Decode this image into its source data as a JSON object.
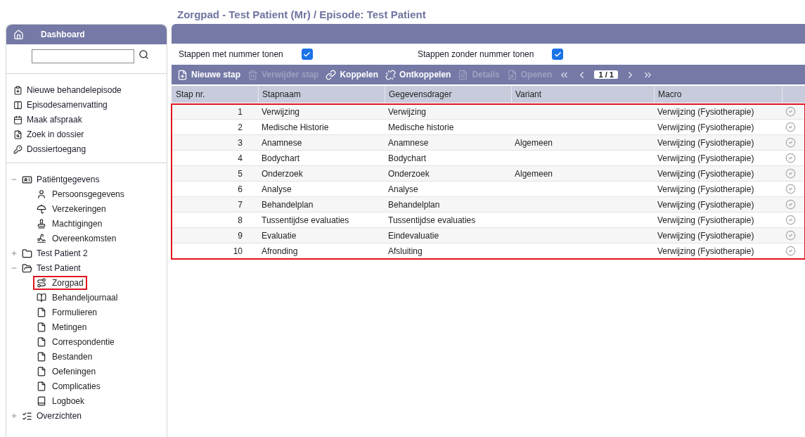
{
  "page_title": "Zorgpad - Test Patient (Mr) / Episode: Test Patient",
  "sidebar": {
    "header": "Dashboard",
    "links": [
      {
        "label": "Nieuwe behandelepisode"
      },
      {
        "label": "Episodesamenvatting"
      },
      {
        "label": "Maak afspraak"
      },
      {
        "label": "Zoek in dossier"
      },
      {
        "label": "Dossiertoegang"
      }
    ],
    "tree": [
      {
        "label": "Patiëntgegevens",
        "expanded": true,
        "children": [
          {
            "label": "Persoonsgegevens",
            "highlighted": false
          },
          {
            "label": "Verzekeringen",
            "highlighted": false
          },
          {
            "label": "Machtigingen",
            "highlighted": false
          },
          {
            "label": "Overeenkomsten",
            "highlighted": false
          }
        ]
      },
      {
        "label": "Test Patient 2",
        "expanded": false
      },
      {
        "label": "Test Patient",
        "expanded": true,
        "children": [
          {
            "label": "Zorgpad",
            "highlighted": true
          },
          {
            "label": "Behandeljournaal",
            "highlighted": false
          },
          {
            "label": "Formulieren",
            "highlighted": false
          },
          {
            "label": "Metingen",
            "highlighted": false
          },
          {
            "label": "Correspondentie",
            "highlighted": false
          },
          {
            "label": "Bestanden",
            "highlighted": false
          },
          {
            "label": "Oefeningen",
            "highlighted": false
          },
          {
            "label": "Complicaties",
            "highlighted": false
          },
          {
            "label": "Logboek",
            "highlighted": false
          }
        ]
      },
      {
        "label": "Overzichten",
        "expanded": false
      }
    ]
  },
  "options": [
    {
      "label": "Stappen met nummer tonen",
      "checked": true
    },
    {
      "label": "Stappen zonder nummer tonen",
      "checked": true
    }
  ],
  "toolbar": [
    {
      "label": "Nieuwe stap",
      "disabled": false
    },
    {
      "label": "Verwijder stap",
      "disabled": true
    },
    {
      "label": "Koppelen",
      "disabled": false
    },
    {
      "label": "Ontkoppelen",
      "disabled": false
    },
    {
      "label": "Details",
      "disabled": true
    },
    {
      "label": "Openen",
      "disabled": true
    }
  ],
  "pagination": {
    "page": "1 / 1"
  },
  "table": {
    "columns": [
      "Stap nr.",
      "Stapnaam",
      "Gegevensdrager",
      "Variant",
      "Macro"
    ],
    "rows_highlighted": true,
    "rows": [
      {
        "cells": [
          "1",
          "Verwijzing",
          "Verwijzing",
          "",
          "Verwijzing (Fysiotherapie)"
        ]
      },
      {
        "cells": [
          "2",
          "Medische Historie",
          "Medische historie",
          "",
          "Verwijzing (Fysiotherapie)"
        ]
      },
      {
        "cells": [
          "3",
          "Anamnese",
          "Anamnese",
          "Algemeen",
          "Verwijzing (Fysiotherapie)"
        ]
      },
      {
        "cells": [
          "4",
          "Bodychart",
          "Bodychart",
          "",
          "Verwijzing (Fysiotherapie)"
        ]
      },
      {
        "cells": [
          "5",
          "Onderzoek",
          "Onderzoek",
          "Algemeen",
          "Verwijzing (Fysiotherapie)"
        ]
      },
      {
        "cells": [
          "6",
          "Analyse",
          "Analyse",
          "",
          "Verwijzing (Fysiotherapie)"
        ]
      },
      {
        "cells": [
          "7",
          "Behandelplan",
          "Behandelplan",
          "",
          "Verwijzing (Fysiotherapie)"
        ]
      },
      {
        "cells": [
          "8",
          "Tussentijdse evaluaties",
          "Tussentijdse evaluaties",
          "",
          "Verwijzing (Fysiotherapie)"
        ]
      },
      {
        "cells": [
          "9",
          "Evaluatie",
          "Eindevaluatie",
          "",
          "Verwijzing (Fysiotherapie)"
        ]
      },
      {
        "cells": [
          "10",
          "Afronding",
          "Afsluiting",
          "",
          "Verwijzing (Fysiotherapie)"
        ]
      }
    ]
  }
}
